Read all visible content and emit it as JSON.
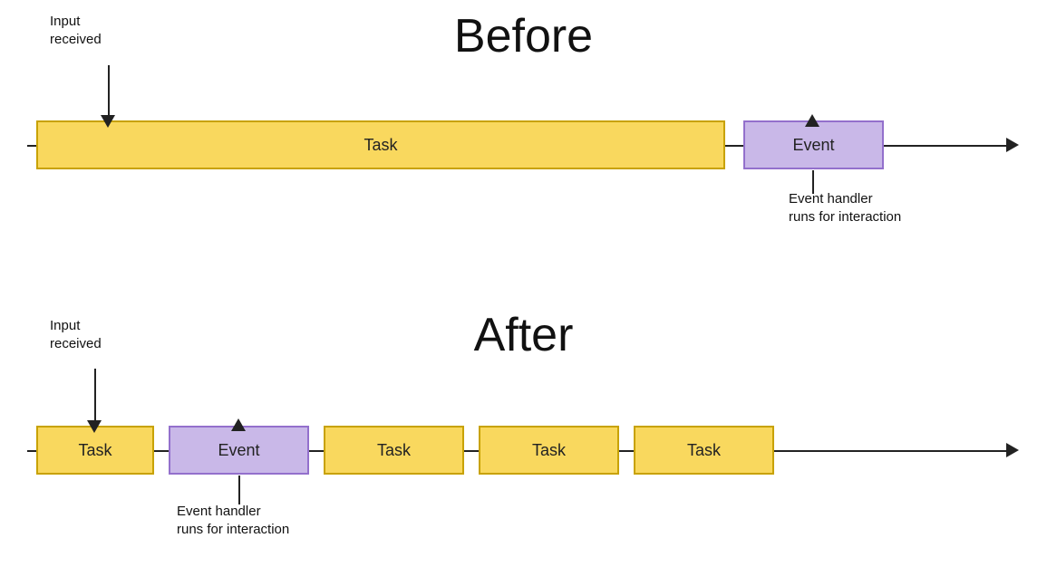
{
  "before": {
    "title": "Before",
    "input_received": "Input\nreceived",
    "task_label": "Task",
    "event_label": "Event",
    "event_handler_label": "Event handler\nruns for interaction"
  },
  "after": {
    "title": "After",
    "input_received": "Input\nreceived",
    "task_label": "Task",
    "event_label": "Event",
    "task2_label": "Task",
    "task3_label": "Task",
    "task4_label": "Task",
    "event_handler_label": "Event handler\nruns for interaction"
  }
}
